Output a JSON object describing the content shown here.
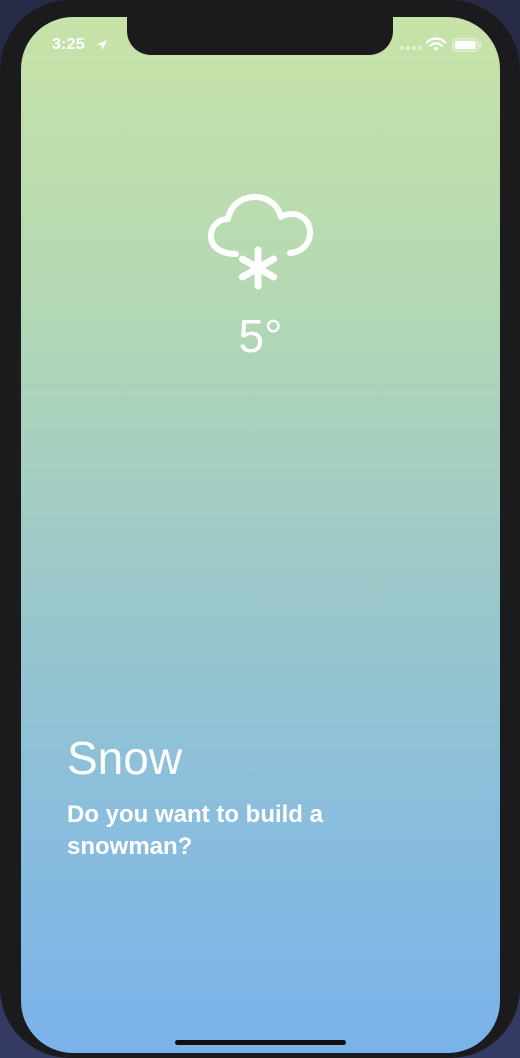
{
  "status_bar": {
    "time": "3:25",
    "icons": [
      "location-arrow-icon",
      "signal-icon",
      "wifi-icon",
      "battery-icon"
    ]
  },
  "weather": {
    "icon": "cloud-snow-icon",
    "temperature": "5°",
    "condition": "Snow",
    "message": "Do you want to build a snowman?"
  },
  "colors": {
    "gradient_top": "#c8e3a8",
    "gradient_bottom": "#7ab2ea",
    "text": "#ffffff",
    "bezel": "#1b1b1d"
  }
}
